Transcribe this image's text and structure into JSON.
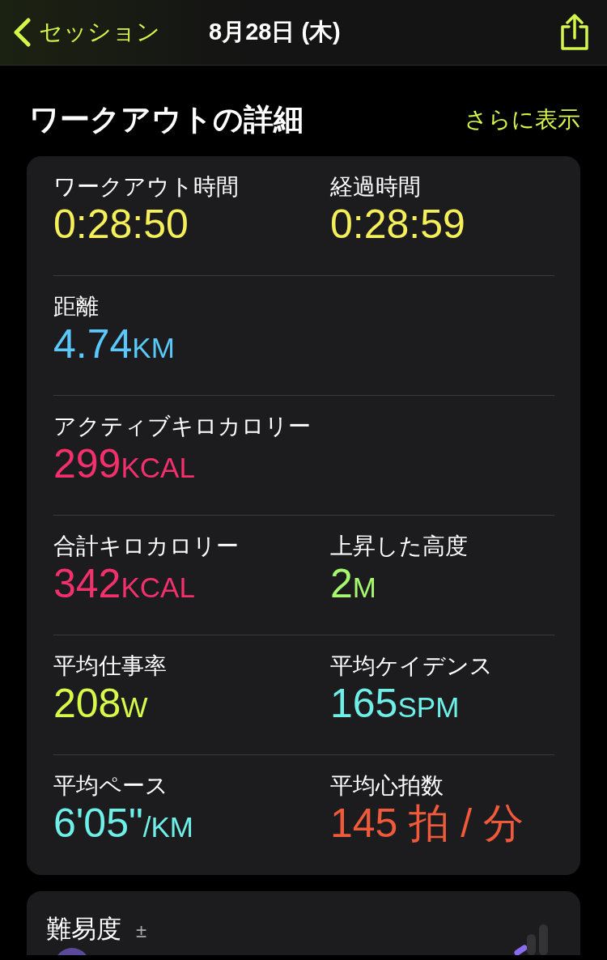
{
  "nav": {
    "back_label": "セッション",
    "title": "8月28日 (木)"
  },
  "section": {
    "title": "ワークアウトの詳細",
    "more_link": "さらに表示"
  },
  "rows": [
    {
      "metrics": [
        {
          "label": "ワークアウト時間",
          "value": "0:28:50",
          "color": "#f5ef5a"
        },
        {
          "label": "経過時間",
          "value": "0:28:59",
          "color": "#f5ef5a"
        }
      ]
    },
    {
      "metrics": [
        {
          "label": "距離",
          "value": "4.74",
          "unit": "KM",
          "color": "#5ac8fa"
        }
      ]
    },
    {
      "metrics": [
        {
          "label": "アクティブキロカロリー",
          "value": "299",
          "unit": "KCAL",
          "color": "#f2306b"
        }
      ]
    },
    {
      "metrics": [
        {
          "label": "合計キロカロリー",
          "value": "342",
          "unit": "KCAL",
          "color": "#f2306b"
        },
        {
          "label": "上昇した高度",
          "value": "2",
          "unit": "M",
          "color": "#a6f86e"
        }
      ]
    },
    {
      "metrics": [
        {
          "label": "平均仕事率",
          "value": "208",
          "unit": "W",
          "color": "#d6f94a"
        },
        {
          "label": "平均ケイデンス",
          "value": "165",
          "unit": "SPM",
          "color": "#6ef0e8"
        }
      ]
    },
    {
      "metrics": [
        {
          "label": "平均ペース",
          "value": "6'05\"",
          "unit": "/KM",
          "color": "#6ef0e8"
        },
        {
          "label": "平均心拍数",
          "value": "145 拍 / 分",
          "color": "#f05a3a"
        }
      ]
    }
  ],
  "effort": {
    "title": "難易度",
    "badge": "±"
  }
}
